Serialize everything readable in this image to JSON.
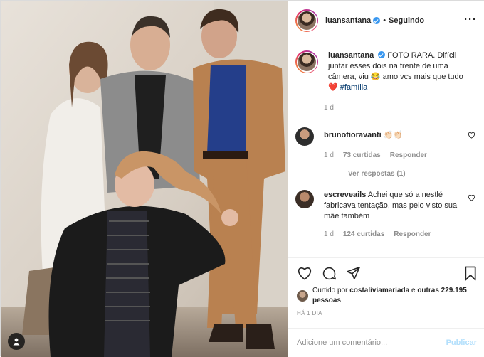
{
  "header": {
    "username": "luansantana",
    "separator": "•",
    "follow_status": "Seguindo",
    "more_icon": "ellipsis-icon"
  },
  "caption": {
    "username": "luansantana",
    "text": "FOTO RARA. Difícil juntar esses dois na frente de uma câmera, viu 😂 amo vcs mais que tudo ❤️",
    "hashtag": "#família",
    "age": "1 d"
  },
  "comments": [
    {
      "username": "brunofioravanti",
      "text": "👏🏻👏🏻",
      "age": "1 d",
      "likes": "73 curtidas",
      "reply_label": "Responder",
      "view_replies": "Ver respostas (1)"
    },
    {
      "username": "escreveails",
      "text": "Achei que só a nestlé fabricava tentação, mas pelo visto sua mãe também",
      "age": "1 d",
      "likes": "124 curtidas",
      "reply_label": "Responder"
    }
  ],
  "likes": {
    "prefix": "Curtido por",
    "user": "costaliviamariada",
    "connector": "e",
    "others": "outras 229.195 pessoas"
  },
  "timestamp": "HÁ 1 DIA",
  "add_comment": {
    "placeholder": "Adicione um comentário...",
    "publish_label": "Publicar"
  },
  "colors": {
    "accent": "#3897f0",
    "publish_disabled": "#b2dffc",
    "heart_red": "#ed4956",
    "hashtag": "#00376b"
  }
}
